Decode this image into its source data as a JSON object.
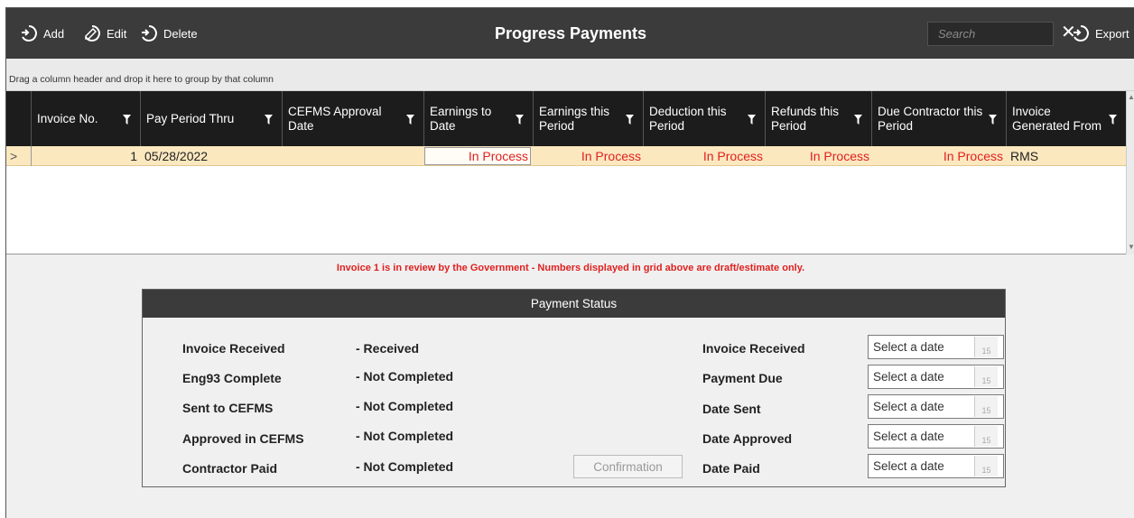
{
  "toolbar": {
    "add_label": "Add",
    "edit_label": "Edit",
    "delete_label": "Delete",
    "title": "Progress Payments",
    "search_placeholder": "Search",
    "export_label": "Export"
  },
  "group_panel": {
    "hint": "Drag a column header and drop it here to group by that column"
  },
  "grid": {
    "columns": [
      "Invoice No.",
      "Pay Period Thru",
      "CEFMS Approval Date",
      "Earnings to Date",
      "Earnings this Period",
      "Deduction this Period",
      "Refunds this Period",
      "Due Contractor this Period",
      "Invoice Generated From"
    ],
    "rows": [
      {
        "indicator": ">",
        "invoice_no": "1",
        "pay_period_thru": "05/28/2022",
        "cefms_approval_date": "",
        "earnings_to_date": "In Process",
        "earnings_this_period": "In Process",
        "deduction_this_period": "In Process",
        "refunds_this_period": "In Process",
        "due_contractor_this_period": "In Process",
        "invoice_generated_from": "RMS"
      }
    ]
  },
  "notice": "Invoice 1 is in review by the Government - Numbers displayed in grid above are draft/estimate only.",
  "payment_status": {
    "title": "Payment Status",
    "statuses": [
      {
        "label": "Invoice Received",
        "value": "- Received"
      },
      {
        "label": "Eng93 Complete",
        "value": "- Not Completed"
      },
      {
        "label": "Sent to CEFMS",
        "value": "- Not Completed"
      },
      {
        "label": "Approved in CEFMS",
        "value": "- Not Completed"
      },
      {
        "label": "Contractor Paid",
        "value": "- Not Completed"
      }
    ],
    "confirmation_label": "Confirmation",
    "dates": [
      {
        "label": "Invoice Received",
        "placeholder": "Select a date"
      },
      {
        "label": "Payment Due",
        "placeholder": "Select a date"
      },
      {
        "label": "Date Sent",
        "placeholder": "Select a date"
      },
      {
        "label": "Date Approved",
        "placeholder": "Select a date"
      },
      {
        "label": "Date Paid",
        "placeholder": "Select a date"
      }
    ],
    "calendar_icon_text": "15"
  },
  "colors": {
    "toolbar_bg": "#3b3b3b",
    "grid_header_bg": "#1c1c1c",
    "selected_row_bg": "#fce8bf",
    "alert_red": "#e02020"
  },
  "icons": [
    "add-icon",
    "edit-icon",
    "delete-icon",
    "clear-search-icon",
    "export-icon",
    "filter-icon",
    "calendar-icon"
  ]
}
